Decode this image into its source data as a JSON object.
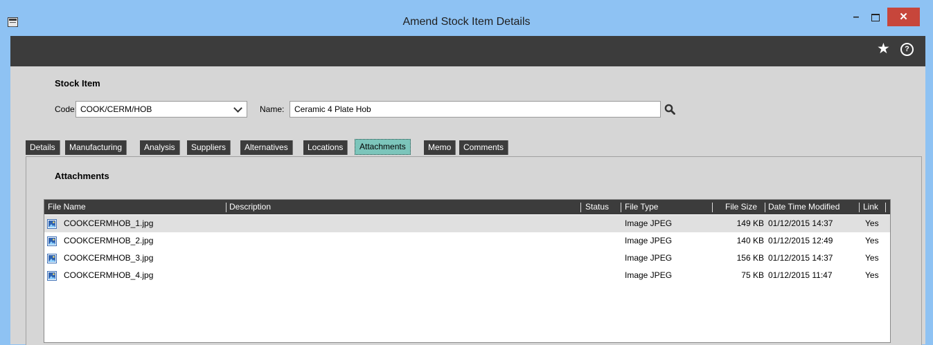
{
  "window": {
    "title": "Amend Stock Item Details",
    "minimize_glyph": "–",
    "close_glyph": "✕",
    "app_icon": "form-window-icon"
  },
  "toolbar": {
    "star_glyph": "★",
    "help_glyph": "?",
    "icons": [
      "star-icon",
      "help-icon"
    ]
  },
  "stock_item": {
    "heading": "Stock Item",
    "code_label": "Code:",
    "code_value": "COOK/CERM/HOB",
    "name_label": "Name:",
    "name_value": "Ceramic 4 Plate Hob"
  },
  "tabs": [
    {
      "label": "Details"
    },
    {
      "label": "Manufacturing"
    },
    {
      "label": "Analysis"
    },
    {
      "label": "Suppliers"
    },
    {
      "label": "Alternatives"
    },
    {
      "label": "Locations"
    },
    {
      "label": "Attachments",
      "active": true
    },
    {
      "label": "Memo"
    },
    {
      "label": "Comments"
    }
  ],
  "attachments": {
    "heading": "Attachments",
    "columns": [
      "File Name",
      "Description",
      "Status",
      "File Type",
      "File Size",
      "Date Time Modified",
      "Link"
    ],
    "rows": [
      {
        "file_name": "COOKCERMHOB_1.jpg",
        "description": "",
        "status": "",
        "file_type": "Image JPEG",
        "file_size": "149 KB",
        "modified": "01/12/2015 14:37",
        "link": "Yes",
        "selected": true
      },
      {
        "file_name": "COOKCERMHOB_2.jpg",
        "description": "",
        "status": "",
        "file_type": "Image JPEG",
        "file_size": "140 KB",
        "modified": "01/12/2015 12:49",
        "link": "Yes"
      },
      {
        "file_name": "COOKCERMHOB_3.jpg",
        "description": "",
        "status": "",
        "file_type": "Image JPEG",
        "file_size": "156 KB",
        "modified": "01/12/2015 14:37",
        "link": "Yes"
      },
      {
        "file_name": "COOKCERMHOB_4.jpg",
        "description": "",
        "status": "",
        "file_type": "Image JPEG",
        "file_size": "75 KB",
        "modified": "01/12/2015 11:47",
        "link": "Yes"
      }
    ]
  },
  "colors": {
    "title_bar": "#8ec2f3",
    "toolbar": "#3c3c3c",
    "panel": "#d6d6d6",
    "active_tab": "#7cc5bb",
    "close_button": "#c7463b"
  }
}
